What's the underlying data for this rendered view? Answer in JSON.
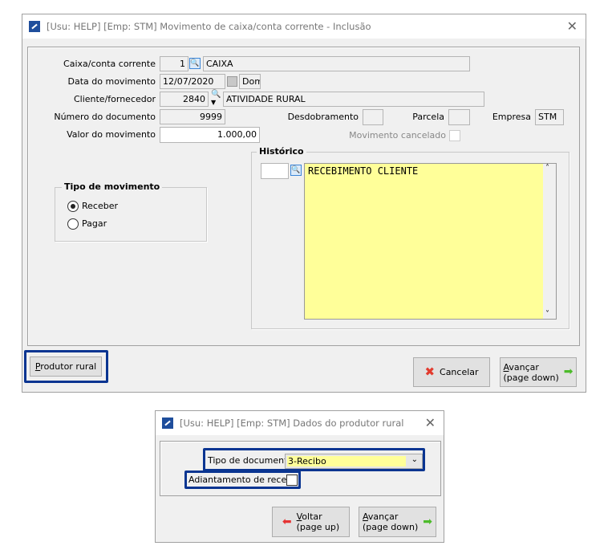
{
  "main_window": {
    "title": "[Usu: HELP] [Emp: STM] Movimento de caixa/conta corrente - Inclusão",
    "fields": {
      "caixa_label": "Caixa/conta corrente",
      "caixa_code": "1",
      "caixa_name": "CAIXA",
      "data_label": "Data do movimento",
      "data_value": "12/07/2020",
      "data_weekday": "Dom",
      "cliente_label": "Cliente/fornecedor",
      "cliente_code": "2840",
      "cliente_name": "ATIVIDADE RURAL",
      "numero_label": "Número do documento",
      "numero_value": "9999",
      "desdobramento_label": "Desdobramento",
      "desdobramento_value": "",
      "parcela_label": "Parcela",
      "parcela_value": "",
      "empresa_label": "Empresa",
      "empresa_value": "STM",
      "valor_label": "Valor do movimento",
      "valor_value": "1.000,00",
      "cancelado_label": "Movimento cancelado",
      "cancelado_checked": false
    },
    "historico": {
      "title": "Histórico",
      "code": "",
      "text": "RECEBIMENTO CLIENTE"
    },
    "tipo_movimento": {
      "title": "Tipo de movimento",
      "options": [
        {
          "label": "Receber",
          "selected": true
        },
        {
          "label": "Pagar",
          "selected": false
        }
      ]
    },
    "buttons": {
      "produtor_first": "P",
      "produtor_rest": "rodutor rural",
      "cancelar": "Cancelar",
      "avancar_first": "A",
      "avancar_rest": "vançar",
      "avancar_sub": "(page down)"
    }
  },
  "dialog": {
    "title": "[Usu: HELP] [Emp: STM] Dados do produtor rural",
    "tipo_doc_label": "Tipo de documento",
    "tipo_doc_value": "3-Recibo",
    "adiantamento_label": "Adiantamento de receita",
    "adiantamento_checked": false,
    "buttons": {
      "voltar_first": "V",
      "voltar_rest": "oltar",
      "voltar_sub": "(page up)",
      "avancar_first": "A",
      "avancar_rest": "vançar",
      "avancar_sub": "(page down)"
    }
  },
  "colors": {
    "highlight": "#0a3591",
    "memo": "#ffff99"
  }
}
